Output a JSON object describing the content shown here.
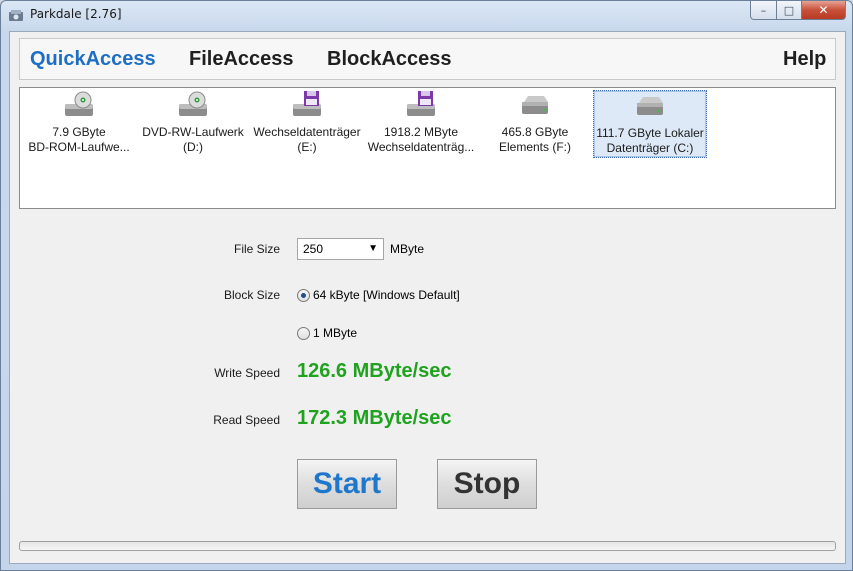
{
  "window": {
    "title": "Parkdale [2.76]"
  },
  "menu": {
    "quick": "QuickAccess",
    "file": "FileAccess",
    "block": "BlockAccess",
    "help": "Help"
  },
  "drives": [
    {
      "line1": "7.9 GByte",
      "line2": "BD-ROM-Laufwe...",
      "icon": "optical-drive-icon",
      "selected": false
    },
    {
      "line1": "DVD-RW-Laufwerk",
      "line2": "(D:)",
      "icon": "optical-drive-icon",
      "selected": false
    },
    {
      "line1": "Wechseldatenträger",
      "line2": "(E:)",
      "icon": "removable-drive-icon",
      "selected": false
    },
    {
      "line1": "1918.2 MByte",
      "line2": "Wechseldatenträg...",
      "icon": "removable-drive-icon",
      "selected": false
    },
    {
      "line1": "465.8 GByte",
      "line2": "Elements (F:)",
      "icon": "hard-drive-icon",
      "selected": false
    },
    {
      "line1": "111.7 GByte Lokaler",
      "line2": "Datenträger (C:)",
      "icon": "hard-drive-icon",
      "selected": true
    }
  ],
  "settings": {
    "file_size_label": "File Size",
    "file_size_value": "250",
    "file_size_unit": "MByte",
    "block_size_label": "Block Size",
    "block_option_1": "64 kByte [Windows Default]",
    "block_option_2": "1 MByte",
    "selected_block": "64 kByte [Windows Default]"
  },
  "results": {
    "write_label": "Write Speed",
    "write_value": "126.6 MByte/sec",
    "read_label": "Read Speed",
    "read_value": "172.3 MByte/sec"
  },
  "buttons": {
    "start": "Start",
    "stop": "Stop"
  },
  "progress": {
    "value": 0
  },
  "colors": {
    "accent": "#1e6fc4",
    "speed": "#1fa31f"
  }
}
